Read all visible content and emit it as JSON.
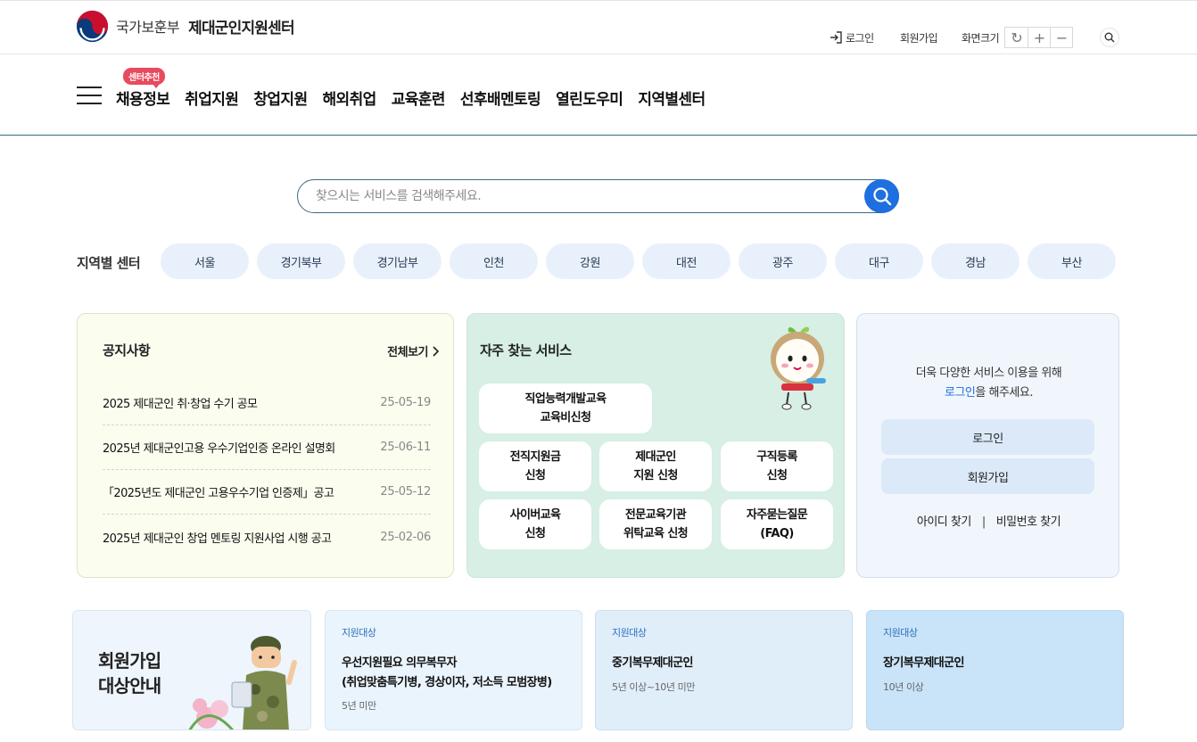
{
  "header": {
    "ministry": "국가보훈부",
    "center": "제대군인지원센터",
    "login": "로그인",
    "join": "회원가입",
    "screen_size": "화면크기",
    "size_reset": "↻",
    "size_plus": "+",
    "size_minus": "−"
  },
  "gnb": {
    "badge": "센터추천",
    "items": [
      "채용정보",
      "취업지원",
      "창업지원",
      "해외취업",
      "교육훈련",
      "선후배멘토링",
      "열린도우미",
      "지역별센터"
    ]
  },
  "search": {
    "placeholder": "찾으시는 서비스를 검색해주세요."
  },
  "regions": {
    "label": "지역별 센터",
    "items": [
      "서울",
      "경기북부",
      "경기남부",
      "인천",
      "강원",
      "대전",
      "광주",
      "대구",
      "경남",
      "부산"
    ]
  },
  "notice": {
    "title": "공지사항",
    "more": "전체보기",
    "items": [
      {
        "text": "2025 제대군인 취·창업 수기 공모",
        "date": "25-05-19"
      },
      {
        "text": "2025년 제대군인고용 우수기업인증 온라인 설명회",
        "date": "25-06-11"
      },
      {
        "text": "「2025년도 제대군인 고용우수기업 인증제」공고",
        "date": "25-05-12"
      },
      {
        "text": "2025년 제대군인 창업 멘토링 지원사업 시행 공고",
        "date": "25-02-06"
      }
    ]
  },
  "frequent": {
    "title": "자주 찾는 서비스",
    "services": [
      "직업능력개발교육\n교육비신청",
      "전직지원금\n신청",
      "제대군인\n지원 신청",
      "구직등록\n신청",
      "사이버교육\n신청",
      "전문교육기관\n위탁교육 신청",
      "자주묻는질문\n(FAQ)"
    ]
  },
  "login_box": {
    "message_line1": "더욱 다양한 서비스 이용을 위해",
    "message_link": "로그인",
    "message_tail": "을 해주세요.",
    "login_btn": "로그인",
    "join_btn": "회원가입",
    "find_id": "아이디 찾기",
    "separator": "|",
    "find_pw": "비밀번호 찾기"
  },
  "bottom": {
    "guide_title": "회원가입\n대상안내",
    "targets": [
      {
        "tag": "지원대상",
        "title": "우선지원필요 의무복무자\n(취업맞춤특기병, 경상이자, 저소득 모범장병)",
        "sub": "5년 미만"
      },
      {
        "tag": "지원대상",
        "title": "중기복무제대군인",
        "sub": "5년 이상~10년 미만"
      },
      {
        "tag": "지원대상",
        "title": "장기복무제대군인",
        "sub": "10년 이상"
      }
    ]
  },
  "colors": {
    "accent": "#1e6fe0",
    "badge": "#e84a5f",
    "notice_bg": "#fbfdef",
    "frequent_bg": "#d7efe5",
    "login_bg": "#f1f6fc"
  }
}
